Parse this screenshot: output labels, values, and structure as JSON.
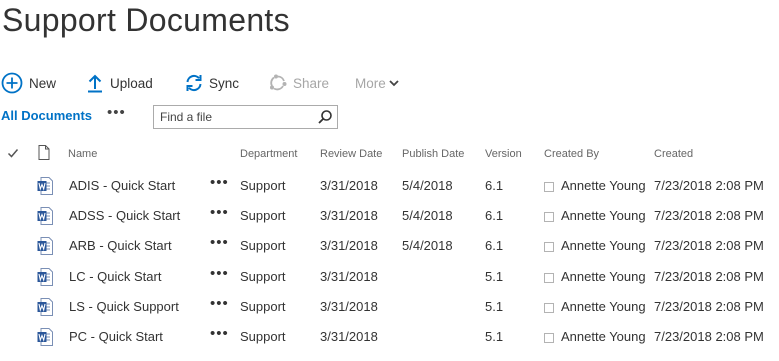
{
  "page": {
    "title": "Support Documents"
  },
  "toolbar": {
    "new_label": "New",
    "upload_label": "Upload",
    "sync_label": "Sync",
    "share_label": "Share",
    "more_label": "More"
  },
  "view": {
    "current": "All Documents",
    "more": "•••",
    "search_placeholder": "Find a file"
  },
  "columns": {
    "name": "Name",
    "department": "Department",
    "review_date": "Review Date",
    "publish_date": "Publish Date",
    "version": "Version",
    "created_by": "Created By",
    "created": "Created"
  },
  "row_more": "•••",
  "rows": [
    {
      "name": "ADIS - Quick Start",
      "department": "Support",
      "review_date": "3/31/2018",
      "publish_date": "5/4/2018",
      "version": "6.1",
      "created_by": "Annette Young",
      "created": "7/23/2018 2:08 PM"
    },
    {
      "name": "ADSS - Quick Start",
      "department": "Support",
      "review_date": "3/31/2018",
      "publish_date": "5/4/2018",
      "version": "6.1",
      "created_by": "Annette Young",
      "created": "7/23/2018 2:08 PM"
    },
    {
      "name": "ARB - Quick Start",
      "department": "Support",
      "review_date": "3/31/2018",
      "publish_date": "5/4/2018",
      "version": "6.1",
      "created_by": "Annette Young",
      "created": "7/23/2018 2:08 PM"
    },
    {
      "name": "LC - Quick Start",
      "department": "Support",
      "review_date": "3/31/2018",
      "publish_date": "",
      "version": "5.1",
      "created_by": "Annette Young",
      "created": "7/23/2018 2:08 PM"
    },
    {
      "name": "LS - Quick Support",
      "department": "Support",
      "review_date": "3/31/2018",
      "publish_date": "",
      "version": "5.1",
      "created_by": "Annette Young",
      "created": "7/23/2018 2:08 PM"
    },
    {
      "name": "PC - Quick Start",
      "department": "Support",
      "review_date": "3/31/2018",
      "publish_date": "",
      "version": "5.1",
      "created_by": "Annette Young",
      "created": "7/23/2018 2:08 PM"
    }
  ],
  "colors": {
    "accent": "#0072c6",
    "word_icon": "#2b579a",
    "text": "#333333",
    "header_text": "#666666",
    "disabled": "#a6a6a6"
  }
}
